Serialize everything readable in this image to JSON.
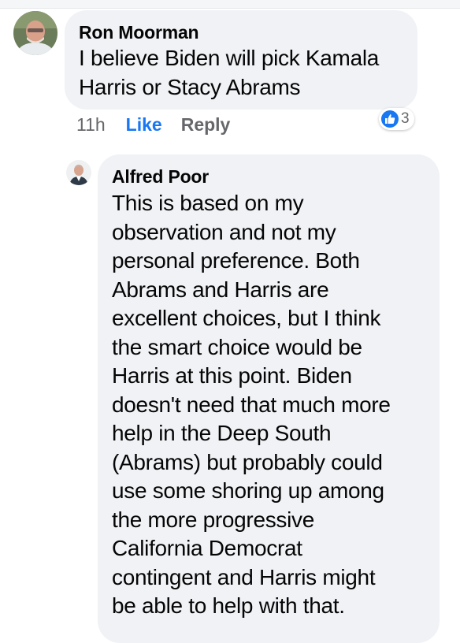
{
  "colors": {
    "like_blue": "#1877f2",
    "meta_gray": "#65676b",
    "bubble_bg": "#f0f2f5",
    "text": "#050505"
  },
  "comments": [
    {
      "author": "Ron Moorman",
      "text_lines": [
        "I believe Biden will pick Kamala",
        "Harris or Stacy Abrams"
      ],
      "avatar_icon": "user-avatar-photo",
      "time": "11h",
      "like_label": "Like",
      "reply_label": "Reply",
      "reaction_icon": "thumbs-up-icon",
      "reaction_count": "3"
    },
    {
      "author": "Alfred Poor",
      "avatar_icon": "user-avatar-photo",
      "text_lines": [
        "This is based on my",
        "observation and not my",
        "personal preference. Both",
        "Abrams and Harris are",
        "excellent choices, but I think",
        "the smart choice would be",
        "Harris at this point. Biden",
        "doesn't need that much more",
        "help in the Deep South",
        "(Abrams) but probably could",
        "use some shoring up among",
        "the more progressive",
        "California Democrat",
        "contingent and Harris might",
        "be able to help with that."
      ]
    }
  ]
}
